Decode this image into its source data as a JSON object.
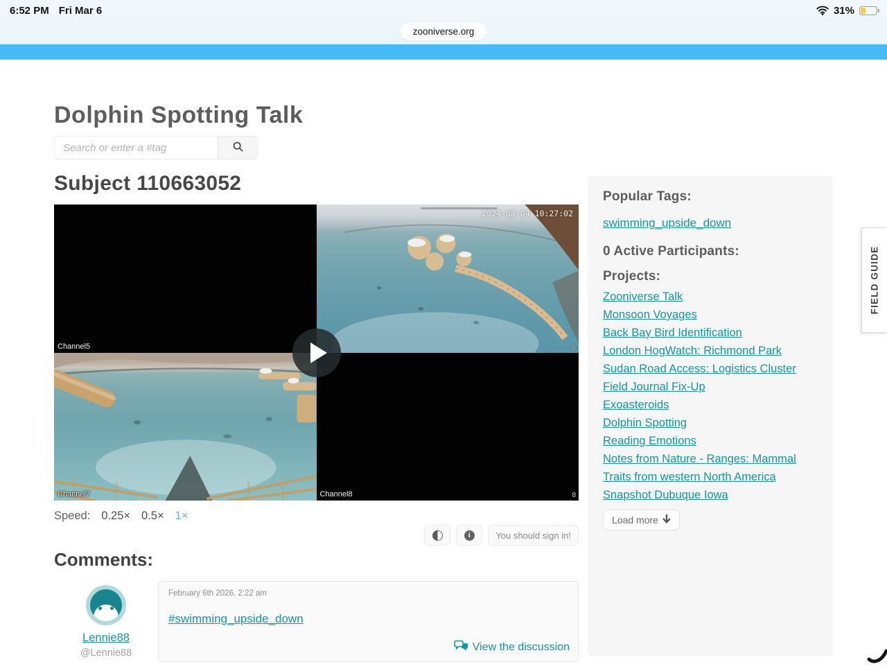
{
  "status_bar": {
    "time": "6:52 PM",
    "date": "Fri Mar 6",
    "battery_percent": "31%"
  },
  "browser": {
    "url": "zooniverse.org"
  },
  "colors": {
    "accent_teal": "#14979c",
    "header_blue": "#45bcf9",
    "speed_active_blue": "#5fb1f1",
    "battery_yellow": "#f7ce45"
  },
  "page": {
    "board_title": "Dolphin Spotting Talk",
    "search_placeholder": "Search or enter a #tag",
    "subject_title": "Subject 110663052",
    "field_guide_tab": "FIELD GUIDE"
  },
  "player": {
    "timestamp": "2024-08-04 10:27:02",
    "channel_labels": {
      "top_left": "Channel5",
      "bottom_left": "Channel7",
      "bottom_right": "Channel8"
    },
    "corner_digits": {
      "top_right": "6",
      "bottom_right": "8"
    },
    "speed": {
      "label": "Speed:",
      "options": [
        "0.25×",
        "0.5×",
        "1×"
      ],
      "active": "1×"
    },
    "signin_button": "You should sign in!"
  },
  "comments": {
    "heading": "Comments:",
    "comment": {
      "username": "Lennie88",
      "handle": "@Lennie88",
      "timestamp": "February 6th 2026, 2:22 am",
      "body": "#swimming_upside_down",
      "action": "View the discussion"
    }
  },
  "sidebar": {
    "popular_tags_heading": "Popular Tags:",
    "tag": "swimming_upside_down",
    "participants_heading": "0 Active Participants:",
    "projects_heading": "Projects:",
    "projects": [
      "Zooniverse Talk",
      "Monsoon Voyages",
      "Back Bay Bird Identification",
      "London HogWatch: Richmond Park",
      "Sudan Road Access: Logistics Cluster",
      "Field Journal Fix-Up",
      "Exoasteroids",
      "Dolphin Spotting",
      "Reading Emotions",
      "Notes from Nature - Ranges: Mammal Traits from western North America",
      "Snapshot Dubuque Iowa"
    ],
    "load_more": "Load more"
  }
}
